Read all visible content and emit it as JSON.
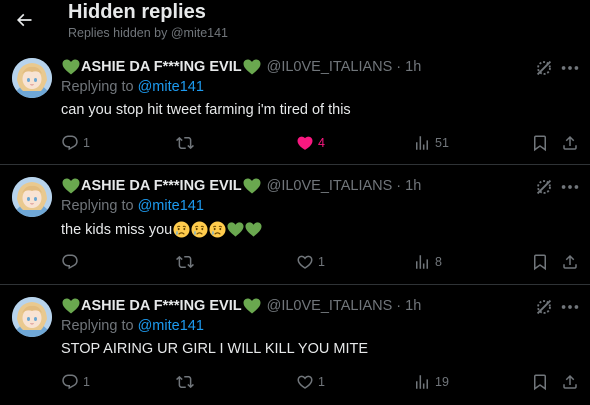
{
  "header": {
    "title": "Hidden replies",
    "subtitle": "Replies hidden by @mite141"
  },
  "colors": {
    "background": "#000000",
    "text": "#e7e9ea",
    "muted": "#71767b",
    "link": "#1d9bf0",
    "like": "#f91880",
    "divider": "#2f3336",
    "green_heart": "#6aa84f"
  },
  "tweets": [
    {
      "name": "ASHIE DA F***ING EVIL",
      "handle": "@IL0VE_ITALIANS",
      "dot": "·",
      "time": "1h",
      "replying_prefix": "Replying to ",
      "replying_to": "@mite141",
      "text": "can you stop hit tweet farming i'm tired of this",
      "emojis": [],
      "replies": "1",
      "retweets": "",
      "likes": "4",
      "liked": true,
      "views": "51"
    },
    {
      "name": "ASHIE DA F***ING EVIL",
      "handle": "@IL0VE_ITALIANS",
      "dot": "·",
      "time": "1h",
      "replying_prefix": "Replying to ",
      "replying_to": "@mite141",
      "text": "the kids miss you",
      "emojis": [
        "crying-face",
        "crying-face",
        "crying-face",
        "green-heart",
        "green-heart"
      ],
      "replies": "",
      "retweets": "",
      "likes": "1",
      "liked": false,
      "views": "8"
    },
    {
      "name": "ASHIE DA F***ING EVIL",
      "handle": "@IL0VE_ITALIANS",
      "dot": "·",
      "time": "1h",
      "replying_prefix": "Replying to ",
      "replying_to": "@mite141",
      "text": "STOP AIRING UR GIRL I WILL KILL YOU MITE",
      "emojis": [],
      "replies": "1",
      "retweets": "",
      "likes": "1",
      "liked": false,
      "views": "19"
    }
  ]
}
